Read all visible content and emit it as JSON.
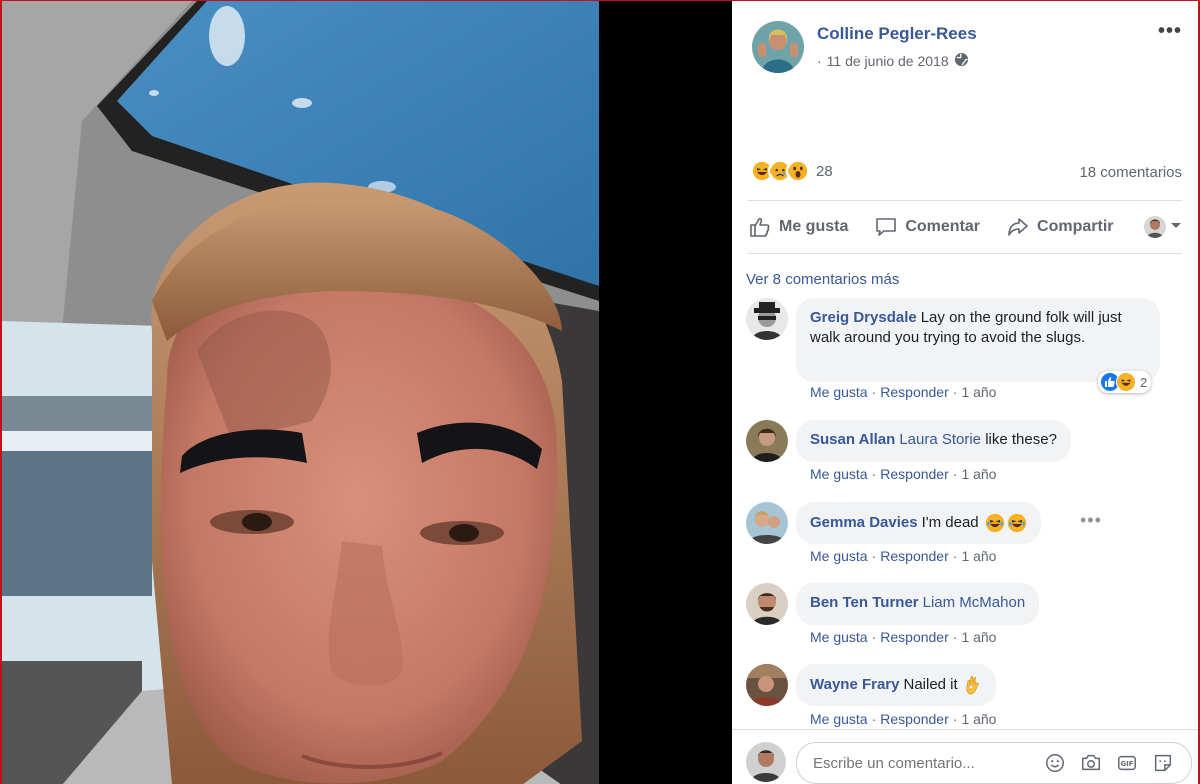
{
  "post": {
    "author": "Colline Pegler-Rees",
    "date": "11 de junio de 2018",
    "privacy_icon": "globe-icon",
    "reaction_count": "28",
    "reactions": [
      "haha",
      "sad",
      "wow"
    ],
    "comments_count": "18 comentarios"
  },
  "actions": {
    "like": "Me gusta",
    "comment": "Comentar",
    "share": "Compartir"
  },
  "view_more": "Ver 8 comentarios más",
  "comments": [
    {
      "name": "Greig Drysdale",
      "text": "Lay on the ground folk will just walk around you trying to avoid the slugs.",
      "like": "Me gusta",
      "reply": "Responder",
      "time": "1 año",
      "reaction_count": "2"
    },
    {
      "name": "Susan Allan",
      "tag": "Laura Storie",
      "text": "like these?",
      "like": "Me gusta",
      "reply": "Responder",
      "time": "1 año"
    },
    {
      "name": "Gemma Davies",
      "text": "I'm dead",
      "like": "Me gusta",
      "reply": "Responder",
      "time": "1 año"
    },
    {
      "name": "Ben Ten Turner",
      "tag": "Liam McMahon",
      "like": "Me gusta",
      "reply": "Responder",
      "time": "1 año"
    },
    {
      "name": "Wayne Frary",
      "text": "Nailed it",
      "like": "Me gusta",
      "reply": "Responder",
      "time": "1 año"
    }
  ],
  "composer": {
    "placeholder": "Escribe un comentario..."
  },
  "colors": {
    "link": "#385898",
    "meta": "#606770",
    "bubble": "#f2f3f5",
    "like_blue": "#1877f2",
    "haha_yellow": "#f7b125"
  }
}
